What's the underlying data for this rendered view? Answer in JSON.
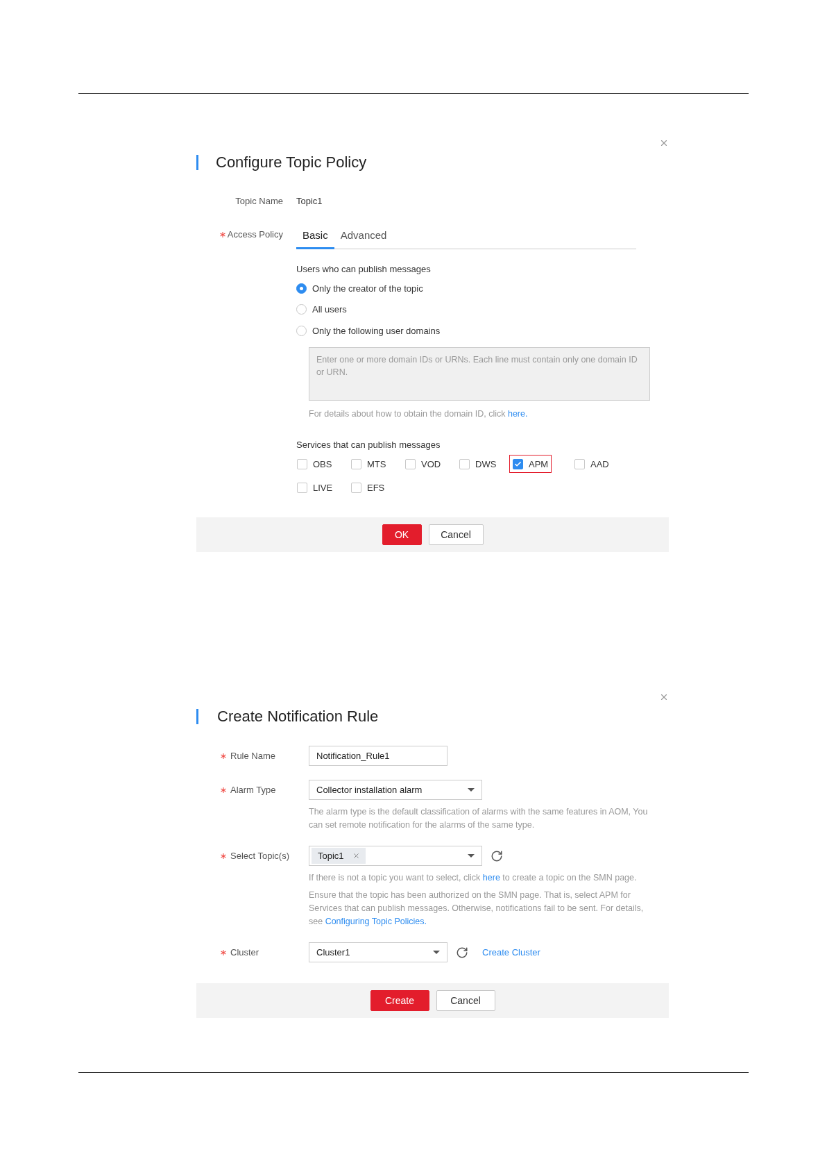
{
  "configure_topic_policy_dialog": {
    "title": "Configure Topic Policy",
    "topic_name": {
      "label": "Topic Name",
      "value": "Topic1"
    },
    "access_policy": {
      "label": "Access Policy",
      "required": true,
      "tabs": [
        {
          "label": "Basic",
          "selected": true
        },
        {
          "label": "Advanced",
          "selected": false
        }
      ]
    },
    "publishers": {
      "heading": "Users who can publish messages",
      "options": [
        {
          "label": "Only the creator of the topic",
          "selected": true
        },
        {
          "label": "All users",
          "selected": false
        },
        {
          "label": "Only the following user domains",
          "selected": false
        }
      ],
      "domains_field": {
        "placeholder": "Enter one or more domain IDs or URNs. Each line must contain only one domain ID or URN."
      },
      "hint": "For details about how to obtain the domain ID, click ",
      "hint_link": "here."
    },
    "services": {
      "heading": "Services that can publish messages",
      "items": [
        {
          "label": "OBS",
          "checked": false,
          "highlighted": false
        },
        {
          "label": "MTS",
          "checked": false,
          "highlighted": false
        },
        {
          "label": "VOD",
          "checked": false,
          "highlighted": false
        },
        {
          "label": "DWS",
          "checked": false,
          "highlighted": false
        },
        {
          "label": "APM",
          "checked": true,
          "highlighted": true
        },
        {
          "label": "AAD",
          "checked": false,
          "highlighted": false
        },
        {
          "label": "LIVE",
          "checked": false,
          "highlighted": false
        },
        {
          "label": "EFS",
          "checked": false,
          "highlighted": false
        }
      ]
    },
    "buttons": [
      {
        "label": "OK",
        "kind": "primary"
      },
      {
        "label": "Cancel",
        "kind": "secondary"
      }
    ]
  },
  "create_notification_rule_dialog": {
    "title": "Create Notification Rule",
    "fields": [
      {
        "kind": "text",
        "label": "Rule Name",
        "required": true,
        "value": "Notification_Rule1"
      },
      {
        "kind": "select",
        "label": "Alarm Type",
        "required": true,
        "value": "Collector installation alarm",
        "notes": [
          [
            {
              "text": "The alarm type is the default classification of alarms with the same features in AOM, You can set remote notification for the alarms of the same type.",
              "link": false
            }
          ]
        ]
      },
      {
        "kind": "tags",
        "label": "Select Topic(s)",
        "required": true,
        "tags": [
          "Topic1"
        ],
        "notes": [
          [
            {
              "text": "If there is not a topic you want to select, click ",
              "link": false
            },
            {
              "text": "here",
              "link": true
            },
            {
              "text": " to create a topic on the SMN page.",
              "link": false
            }
          ],
          [
            {
              "text": "Ensure that the topic has been authorized on the SMN page. That is, select APM for Services that can publish messages. Otherwise, notifications fail to be sent. For details, see ",
              "link": false
            },
            {
              "text": "Configuring Topic Policies.",
              "link": true
            }
          ]
        ]
      },
      {
        "kind": "select_short",
        "label": "Cluster",
        "required": true,
        "value": "Cluster1",
        "link": "Create Cluster"
      }
    ],
    "buttons": [
      {
        "label": "Create",
        "kind": "primary"
      },
      {
        "label": "Cancel",
        "kind": "secondary"
      }
    ]
  }
}
